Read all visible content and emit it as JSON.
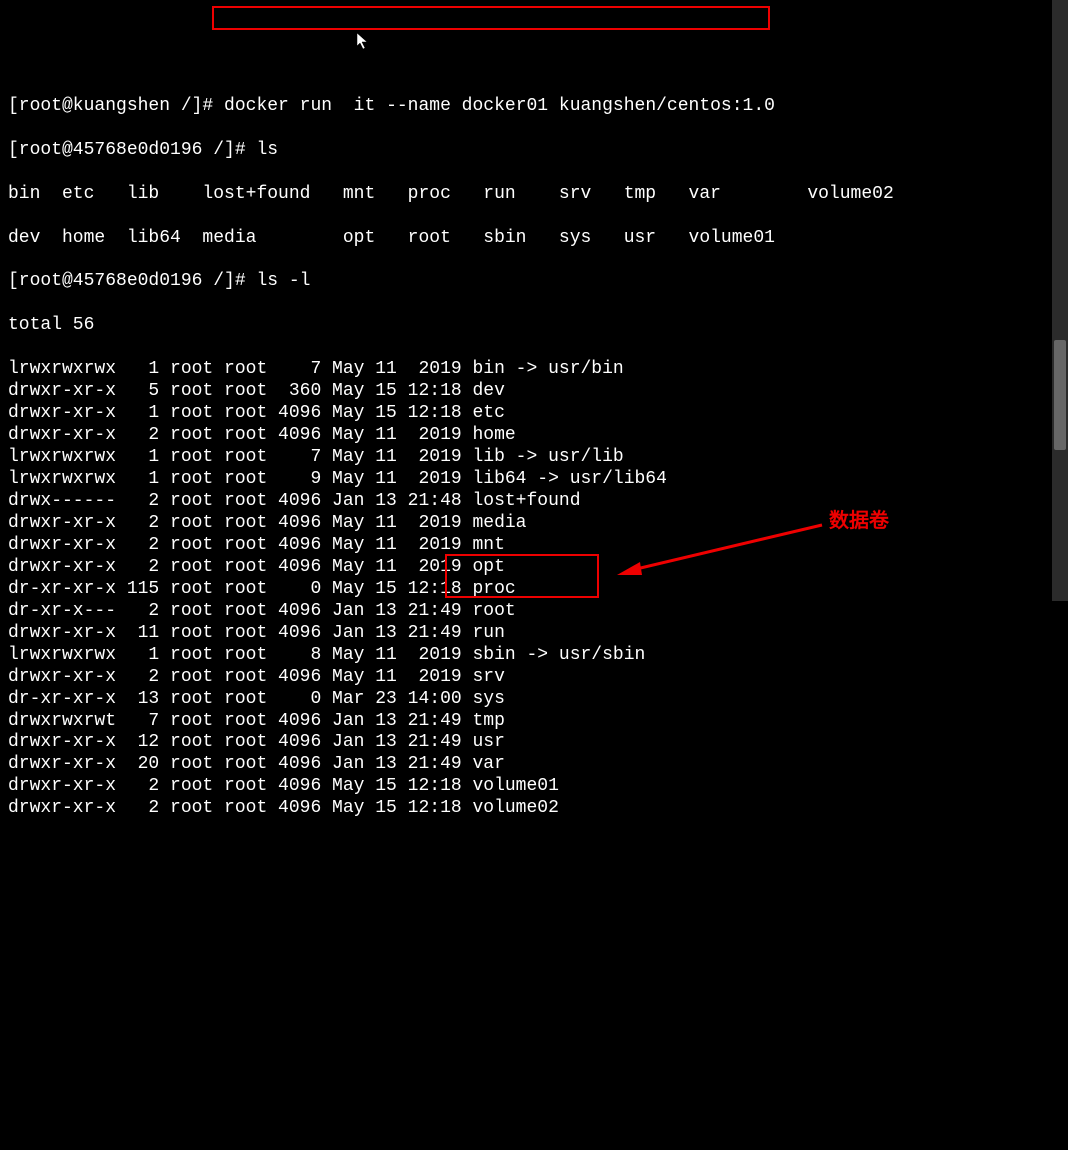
{
  "prompt1": "[root@kuangshen /]# ",
  "cmd1": "docker run  it --name docker01 kuangshen/centos:1.0",
  "prompt2": "[root@45768e0d0196 /]# ",
  "cmd2": "ls",
  "ls_short_line1": "bin  etc   lib    lost+found   mnt   proc   run    srv   tmp   var        volume02",
  "ls_short_line2": "dev  home  lib64  media        opt   root   sbin   sys   usr   volume01",
  "prompt3": "[root@45768e0d0196 /]# ",
  "cmd3": "ls -l",
  "total": "total 56",
  "rows": [
    {
      "perm": "lrwxrwxrwx",
      "links": "1",
      "owner": "root",
      "group": "root",
      "size": "7",
      "month": "May",
      "day": "11",
      "time": "2019",
      "name": "bin -> usr/bin"
    },
    {
      "perm": "drwxr-xr-x",
      "links": "5",
      "owner": "root",
      "group": "root",
      "size": "360",
      "month": "May",
      "day": "15",
      "time": "12:18",
      "name": "dev"
    },
    {
      "perm": "drwxr-xr-x",
      "links": "1",
      "owner": "root",
      "group": "root",
      "size": "4096",
      "month": "May",
      "day": "15",
      "time": "12:18",
      "name": "etc"
    },
    {
      "perm": "drwxr-xr-x",
      "links": "2",
      "owner": "root",
      "group": "root",
      "size": "4096",
      "month": "May",
      "day": "11",
      "time": "2019",
      "name": "home"
    },
    {
      "perm": "lrwxrwxrwx",
      "links": "1",
      "owner": "root",
      "group": "root",
      "size": "7",
      "month": "May",
      "day": "11",
      "time": "2019",
      "name": "lib -> usr/lib"
    },
    {
      "perm": "lrwxrwxrwx",
      "links": "1",
      "owner": "root",
      "group": "root",
      "size": "9",
      "month": "May",
      "day": "11",
      "time": "2019",
      "name": "lib64 -> usr/lib64"
    },
    {
      "perm": "drwx------",
      "links": "2",
      "owner": "root",
      "group": "root",
      "size": "4096",
      "month": "Jan",
      "day": "13",
      "time": "21:48",
      "name": "lost+found"
    },
    {
      "perm": "drwxr-xr-x",
      "links": "2",
      "owner": "root",
      "group": "root",
      "size": "4096",
      "month": "May",
      "day": "11",
      "time": "2019",
      "name": "media"
    },
    {
      "perm": "drwxr-xr-x",
      "links": "2",
      "owner": "root",
      "group": "root",
      "size": "4096",
      "month": "May",
      "day": "11",
      "time": "2019",
      "name": "mnt"
    },
    {
      "perm": "drwxr-xr-x",
      "links": "2",
      "owner": "root",
      "group": "root",
      "size": "4096",
      "month": "May",
      "day": "11",
      "time": "2019",
      "name": "opt"
    },
    {
      "perm": "dr-xr-xr-x",
      "links": "115",
      "owner": "root",
      "group": "root",
      "size": "0",
      "month": "May",
      "day": "15",
      "time": "12:18",
      "name": "proc"
    },
    {
      "perm": "dr-xr-x---",
      "links": "2",
      "owner": "root",
      "group": "root",
      "size": "4096",
      "month": "Jan",
      "day": "13",
      "time": "21:49",
      "name": "root"
    },
    {
      "perm": "drwxr-xr-x",
      "links": "11",
      "owner": "root",
      "group": "root",
      "size": "4096",
      "month": "Jan",
      "day": "13",
      "time": "21:49",
      "name": "run"
    },
    {
      "perm": "lrwxrwxrwx",
      "links": "1",
      "owner": "root",
      "group": "root",
      "size": "8",
      "month": "May",
      "day": "11",
      "time": "2019",
      "name": "sbin -> usr/sbin"
    },
    {
      "perm": "drwxr-xr-x",
      "links": "2",
      "owner": "root",
      "group": "root",
      "size": "4096",
      "month": "May",
      "day": "11",
      "time": "2019",
      "name": "srv"
    },
    {
      "perm": "dr-xr-xr-x",
      "links": "13",
      "owner": "root",
      "group": "root",
      "size": "0",
      "month": "Mar",
      "day": "23",
      "time": "14:00",
      "name": "sys"
    },
    {
      "perm": "drwxrwxrwt",
      "links": "7",
      "owner": "root",
      "group": "root",
      "size": "4096",
      "month": "Jan",
      "day": "13",
      "time": "21:49",
      "name": "tmp"
    },
    {
      "perm": "drwxr-xr-x",
      "links": "12",
      "owner": "root",
      "group": "root",
      "size": "4096",
      "month": "Jan",
      "day": "13",
      "time": "21:49",
      "name": "usr"
    },
    {
      "perm": "drwxr-xr-x",
      "links": "20",
      "owner": "root",
      "group": "root",
      "size": "4096",
      "month": "Jan",
      "day": "13",
      "time": "21:49",
      "name": "var"
    },
    {
      "perm": "drwxr-xr-x",
      "links": "2",
      "owner": "root",
      "group": "root",
      "size": "4096",
      "month": "May",
      "day": "15",
      "time": "12:18",
      "name": "volume01"
    },
    {
      "perm": "drwxr-xr-x",
      "links": "2",
      "owner": "root",
      "group": "root",
      "size": "4096",
      "month": "May",
      "day": "15",
      "time": "12:18",
      "name": "volume02"
    }
  ],
  "annotation_text": "数据卷",
  "cursor_glyph": "↖"
}
